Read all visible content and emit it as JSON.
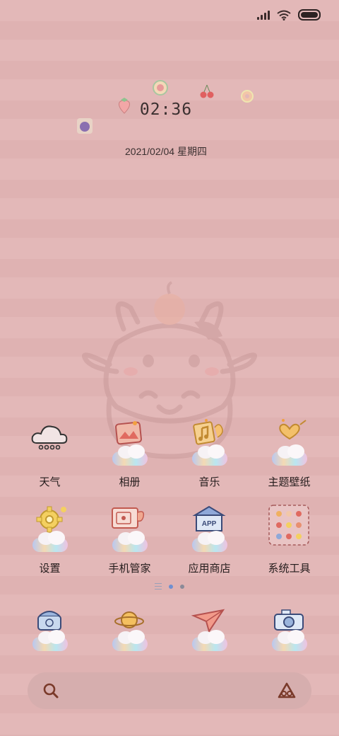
{
  "status_bar": {
    "signal_icon": "signal-bars-icon",
    "wifi_icon": "wifi-icon",
    "battery_icon": "battery-icon"
  },
  "widget": {
    "time": "02:36",
    "date": "2021/02/04 星期四"
  },
  "row1": [
    {
      "label": "天气",
      "icon": "weather-cloud-icon"
    },
    {
      "label": "相册",
      "icon": "gallery-icon"
    },
    {
      "label": "音乐",
      "icon": "music-icon"
    },
    {
      "label": "主题壁纸",
      "icon": "themes-icon"
    }
  ],
  "row2": [
    {
      "label": "设置",
      "icon": "settings-gear-icon"
    },
    {
      "label": "手机管家",
      "icon": "security-icon"
    },
    {
      "label": "应用商店",
      "icon": "app-store-icon"
    },
    {
      "label": "系统工具",
      "icon": "system-tools-folder-icon"
    }
  ],
  "app_store_badge": "APP",
  "dock": [
    {
      "icon": "phone-icon"
    },
    {
      "icon": "browser-planet-icon"
    },
    {
      "icon": "messages-plane-icon"
    },
    {
      "icon": "camera-icon"
    }
  ],
  "page_indicator": {
    "pages": 2,
    "current": 1
  },
  "search_bar": {
    "search_icon": "search-icon",
    "assistant_icon": "assistant-icon"
  },
  "colors": {
    "background": "#e3b8b8",
    "search_bar": "#d6aeae",
    "active_dot": "#6f8fd0"
  }
}
